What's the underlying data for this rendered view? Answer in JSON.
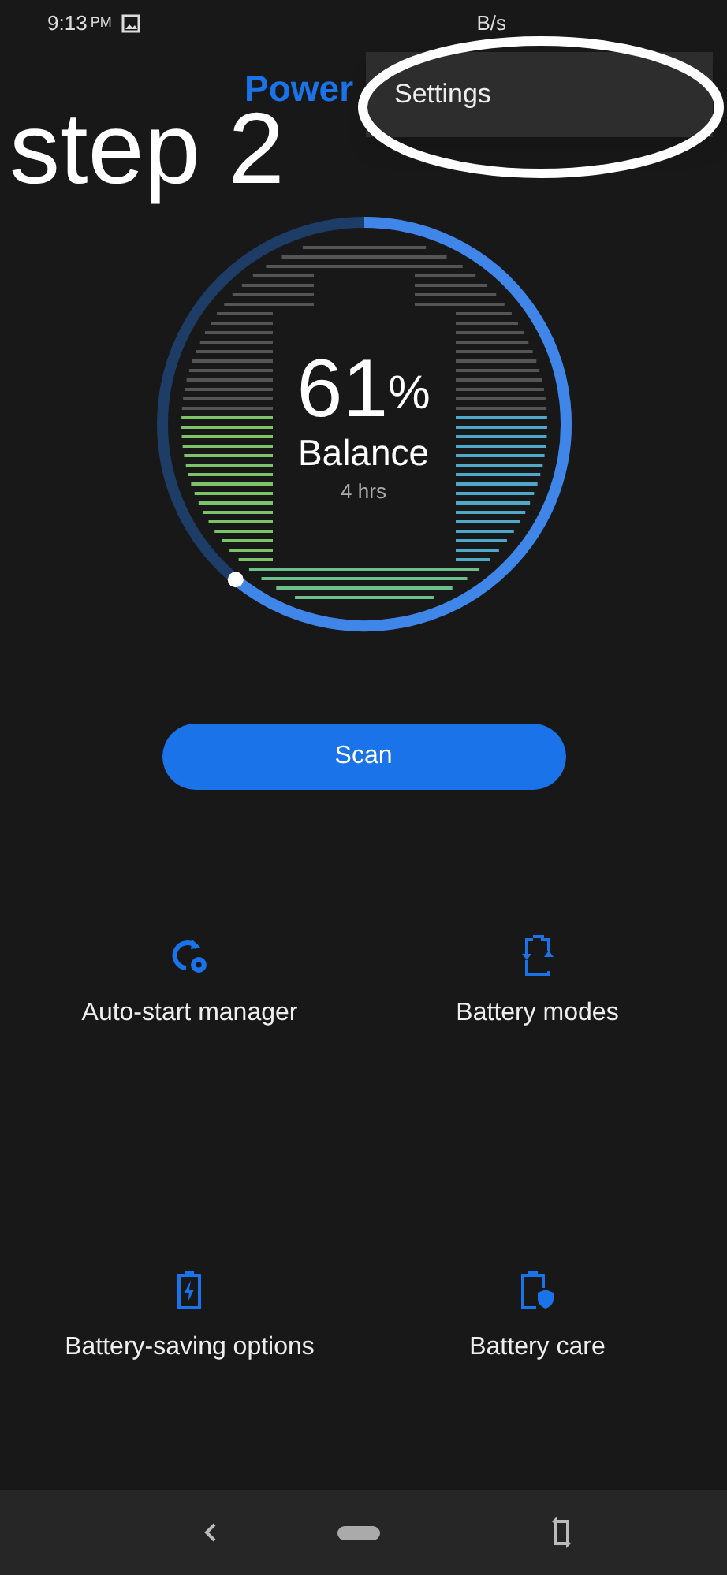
{
  "status_bar": {
    "time": "9:13",
    "meridiem": "PM",
    "speed": "B/s"
  },
  "title": "Power",
  "menu": {
    "items": [
      {
        "label": "Settings"
      }
    ]
  },
  "annotation": {
    "text": "step 2"
  },
  "gauge": {
    "percent": "61",
    "unit": "%",
    "label": "Balance",
    "remaining": "4 hrs"
  },
  "scan_button": "Scan",
  "tools": [
    {
      "label": "Auto-start manager",
      "kind": "autostart"
    },
    {
      "label": "Battery modes",
      "kind": "modes"
    },
    {
      "label": "Battery-saving options",
      "kind": "saving"
    },
    {
      "label": "Battery care",
      "kind": "care"
    }
  ]
}
